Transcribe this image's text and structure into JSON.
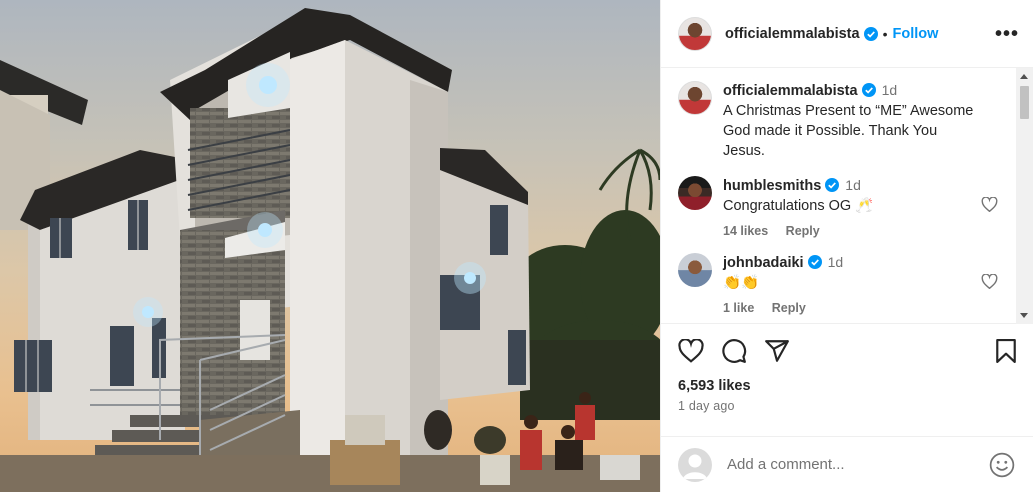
{
  "post": {
    "author": "officialemmalabista",
    "follow_label": "Follow",
    "separator": "•",
    "more_label": "•••",
    "caption": "A Christmas Present to “ME” Awesome God made it Possible. Thank You Jesus.",
    "caption_time": "1d",
    "likes": "6,593 likes",
    "posted_ago": "1 day ago"
  },
  "comments": [
    {
      "user": "humblesmiths",
      "time": "1d",
      "text": "Congratulations OG 🥂",
      "likes": "14 likes",
      "reply": "Reply"
    },
    {
      "user": "johnbadaiki",
      "time": "1d",
      "text": "👏👏",
      "likes": "1 like",
      "reply": "Reply"
    }
  ],
  "add_comment": {
    "placeholder": "Add a comment..."
  },
  "colors": {
    "link": "#0095f6",
    "verified": "#0095f6",
    "muted": "#737373"
  },
  "icons": [
    "verified-badge-icon",
    "more-icon",
    "heart-icon",
    "comment-icon",
    "share-icon",
    "bookmark-icon",
    "emoji-icon",
    "photo-house"
  ]
}
